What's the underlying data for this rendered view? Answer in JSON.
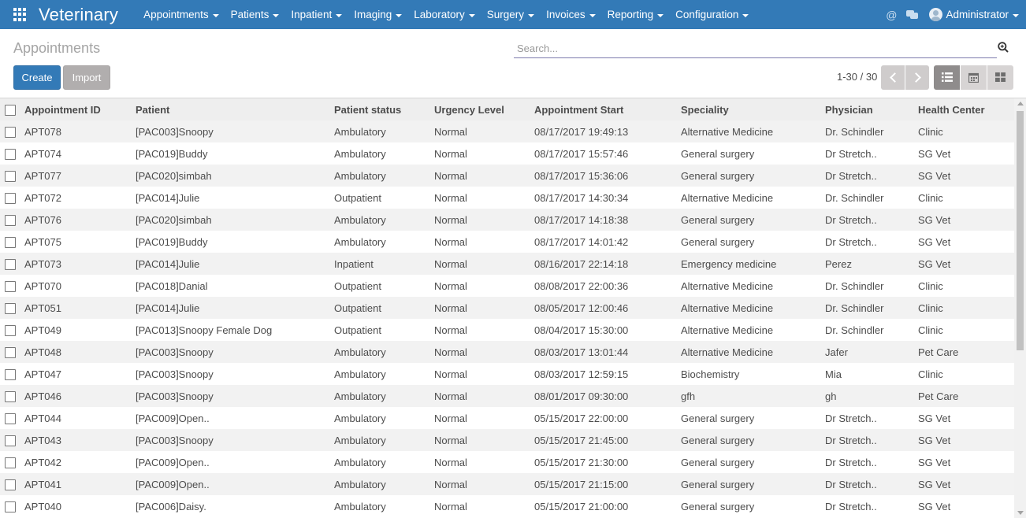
{
  "app": {
    "title": "Veterinary"
  },
  "menu": [
    {
      "label": "Appointments"
    },
    {
      "label": "Patients"
    },
    {
      "label": "Inpatient"
    },
    {
      "label": "Imaging"
    },
    {
      "label": "Laboratory"
    },
    {
      "label": "Surgery"
    },
    {
      "label": "Invoices"
    },
    {
      "label": "Reporting"
    },
    {
      "label": "Configuration"
    }
  ],
  "user": {
    "name": "Administrator"
  },
  "icons": {
    "at": "@",
    "apps": "apps-grid-icon",
    "chat": "chat-icon",
    "search": "search-icon",
    "list": "list-view-icon",
    "calendar": "calendar-view-icon",
    "kanban": "kanban-view-icon"
  },
  "colors": {
    "navbar": "#337ab7",
    "primary": "#337ab7",
    "secondary": "#b1aeae",
    "active_view": "#8f8c8c"
  },
  "breadcrumb": "Appointments",
  "search": {
    "placeholder": "Search...",
    "value": ""
  },
  "buttons": {
    "create": "Create",
    "import": "Import"
  },
  "pager": {
    "value": "1-30 / 30"
  },
  "table": {
    "columns": [
      "Appointment ID",
      "Patient",
      "Patient status",
      "Urgency Level",
      "Appointment Start",
      "Speciality",
      "Physician",
      "Health Center"
    ],
    "rows": [
      [
        "APT078",
        "[PAC003]Snoopy",
        "Ambulatory",
        "Normal",
        "08/17/2017 19:49:13",
        "Alternative Medicine",
        "Dr. Schindler",
        "Clinic"
      ],
      [
        "APT074",
        "[PAC019]Buddy",
        "Ambulatory",
        "Normal",
        "08/17/2017 15:57:46",
        "General surgery",
        "Dr Stretch..",
        "SG Vet"
      ],
      [
        "APT077",
        "[PAC020]simbah",
        "Ambulatory",
        "Normal",
        "08/17/2017 15:36:06",
        "General surgery",
        "Dr Stretch..",
        "SG Vet"
      ],
      [
        "APT072",
        "[PAC014]Julie",
        "Outpatient",
        "Normal",
        "08/17/2017 14:30:34",
        "Alternative Medicine",
        "Dr. Schindler",
        "Clinic"
      ],
      [
        "APT076",
        "[PAC020]simbah",
        "Ambulatory",
        "Normal",
        "08/17/2017 14:18:38",
        "General surgery",
        "Dr Stretch..",
        "SG Vet"
      ],
      [
        "APT075",
        "[PAC019]Buddy",
        "Ambulatory",
        "Normal",
        "08/17/2017 14:01:42",
        "General surgery",
        "Dr Stretch..",
        "SG Vet"
      ],
      [
        "APT073",
        "[PAC014]Julie",
        "Inpatient",
        "Normal",
        "08/16/2017 22:14:18",
        "Emergency medicine",
        "Perez",
        "SG Vet"
      ],
      [
        "APT070",
        "[PAC018]Danial",
        "Outpatient",
        "Normal",
        "08/08/2017 22:00:36",
        "Alternative Medicine",
        "Dr. Schindler",
        "Clinic"
      ],
      [
        "APT051",
        "[PAC014]Julie",
        "Outpatient",
        "Normal",
        "08/05/2017 12:00:46",
        "Alternative Medicine",
        "Dr. Schindler",
        "Clinic"
      ],
      [
        "APT049",
        "[PAC013]Snoopy Female Dog",
        "Outpatient",
        "Normal",
        "08/04/2017 15:30:00",
        "Alternative Medicine",
        "Dr. Schindler",
        "Clinic"
      ],
      [
        "APT048",
        "[PAC003]Snoopy",
        "Ambulatory",
        "Normal",
        "08/03/2017 13:01:44",
        "Alternative Medicine",
        "Jafer",
        "Pet Care"
      ],
      [
        "APT047",
        "[PAC003]Snoopy",
        "Ambulatory",
        "Normal",
        "08/03/2017 12:59:15",
        "Biochemistry",
        "Mia",
        "Clinic"
      ],
      [
        "APT046",
        "[PAC003]Snoopy",
        "Ambulatory",
        "Normal",
        "08/01/2017 09:30:00",
        "gfh",
        "gh",
        "Pet Care"
      ],
      [
        "APT044",
        "[PAC009]Open..",
        "Ambulatory",
        "Normal",
        "05/15/2017 22:00:00",
        "General surgery",
        "Dr Stretch..",
        "SG Vet"
      ],
      [
        "APT043",
        "[PAC003]Snoopy",
        "Ambulatory",
        "Normal",
        "05/15/2017 21:45:00",
        "General surgery",
        "Dr Stretch..",
        "SG Vet"
      ],
      [
        "APT042",
        "[PAC009]Open..",
        "Ambulatory",
        "Normal",
        "05/15/2017 21:30:00",
        "General surgery",
        "Dr Stretch..",
        "SG Vet"
      ],
      [
        "APT041",
        "[PAC009]Open..",
        "Ambulatory",
        "Normal",
        "05/15/2017 21:15:00",
        "General surgery",
        "Dr Stretch..",
        "SG Vet"
      ],
      [
        "APT040",
        "[PAC006]Daisy.",
        "Ambulatory",
        "Normal",
        "05/15/2017 21:00:00",
        "General surgery",
        "Dr Stretch..",
        "SG Vet"
      ]
    ]
  }
}
